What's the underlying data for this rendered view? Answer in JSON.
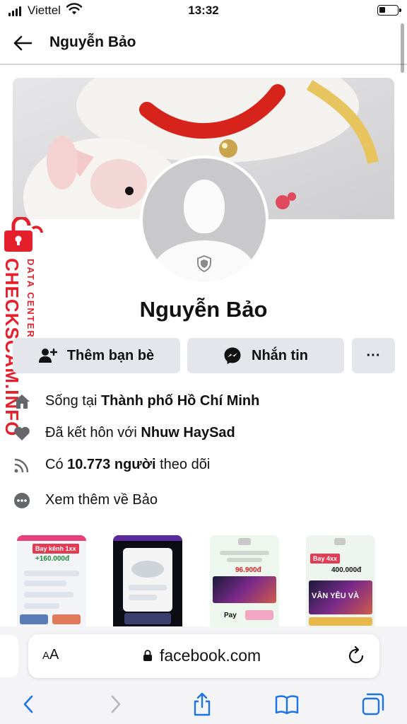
{
  "status_bar": {
    "carrier": "Viettel",
    "time": "13:32",
    "battery_level": 0.35
  },
  "header": {
    "back_icon": "arrow-left-icon",
    "title": "Nguyễn Bảo"
  },
  "profile": {
    "name": "Nguyễn Bảo",
    "avatar_badge_icon": "shield-icon"
  },
  "watermark": {
    "main_text": "CHECKSCAM.INFO",
    "sub_text": "DATA CENTER",
    "color": "#e3202b"
  },
  "actions": {
    "add_friend_label": "Thêm bạn bè",
    "message_label": "Nhắn tin",
    "more_label": "···"
  },
  "info": {
    "lives_prefix": "Sống tại ",
    "lives_value": "Thành phố Hồ Chí Minh",
    "married_prefix": "Đã kết hôn với ",
    "married_value": "Nhuw HaySad",
    "followers_prefix": "Có ",
    "followers_value": "10.773 người",
    "followers_suffix": " theo dõi",
    "see_more": "Xem thêm về Bảo"
  },
  "featured": [
    {
      "tag": "Bay kênh 1xx",
      "amount": "+160.000đ"
    },
    {
      "tag": "",
      "amount": ""
    },
    {
      "tag": "",
      "amount": "96.900đ",
      "extra": "Pay"
    },
    {
      "tag": "Bay 4xx",
      "amount": "400.000đ",
      "extra": "VÂN YÊU VÀ"
    }
  ],
  "browser": {
    "aa_label": "AA",
    "url": "facebook.com"
  },
  "colors": {
    "button_bg": "#e4e6eb",
    "safari_blue": "#1a73e8"
  }
}
